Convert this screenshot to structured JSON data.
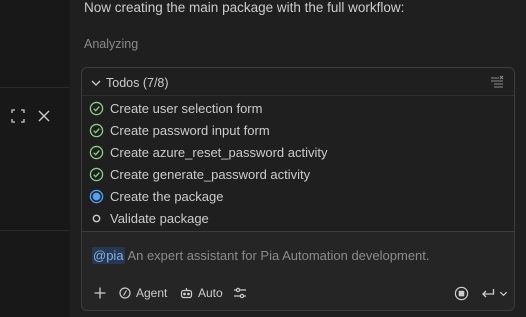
{
  "message": "Now creating the main package with the full workflow:",
  "status": "Analyzing",
  "todos": {
    "title": "Todos (7/8)",
    "items": [
      {
        "label": "Create user selection form",
        "state": "done"
      },
      {
        "label": "Create password input form",
        "state": "done"
      },
      {
        "label": "Create azure_reset_password activity",
        "state": "done"
      },
      {
        "label": "Create generate_password activity",
        "state": "done"
      },
      {
        "label": "Create the package",
        "state": "in-progress"
      },
      {
        "label": "Validate package",
        "state": "pending"
      }
    ]
  },
  "input": {
    "mention": "@pia",
    "description": " An expert assistant for Pia Automation development."
  },
  "toolbar": {
    "agent_label": "Agent",
    "auto_label": "Auto"
  },
  "colors": {
    "done": "#89d185",
    "in_progress": "#4fa3f7",
    "mention_bg": "#26374f"
  },
  "icons": [
    "fullscreen-icon",
    "close-icon",
    "chevron-down-icon",
    "clear-all-icon",
    "check-circle-icon",
    "progress-circle-icon",
    "pending-circle-icon",
    "plus-icon",
    "agent-icon",
    "robot-icon",
    "tools-icon",
    "stop-icon",
    "send-icon",
    "chevron-down-icon"
  ]
}
